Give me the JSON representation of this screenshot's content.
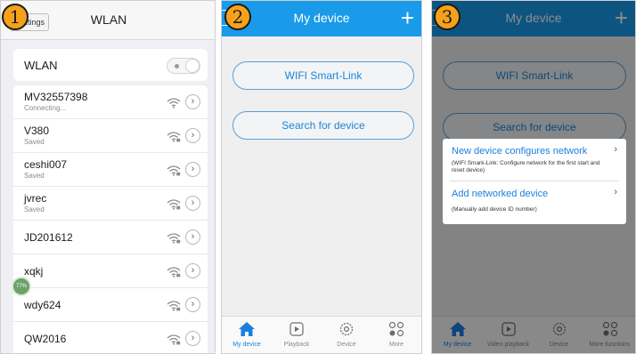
{
  "badges": [
    "1",
    "2",
    "3"
  ],
  "colors": {
    "accent": "#199bea",
    "badge": "#f6a11c",
    "link": "#1a7fe0"
  },
  "screen1": {
    "back_label": "ttings",
    "title": "WLAN",
    "wlan_label": "WLAN",
    "toggle_on": false,
    "networks": [
      {
        "name": "MV32557398",
        "status": "Connecting...",
        "secured": false
      },
      {
        "name": "V380",
        "status": "Saved",
        "secured": true
      },
      {
        "name": "ceshi007",
        "status": "Saved",
        "secured": true
      },
      {
        "name": "jvrec",
        "status": "Saved",
        "secured": true
      },
      {
        "name": "JD201612",
        "status": "",
        "secured": true
      },
      {
        "name": "xqkj",
        "status": "",
        "secured": true
      },
      {
        "name": "wdy624",
        "status": "",
        "secured": true
      },
      {
        "name": "QW2016",
        "status": "",
        "secured": true
      }
    ],
    "floating_ball_text": "77%"
  },
  "screen2": {
    "header_left": "o",
    "title": "My device",
    "plus": "+",
    "wifi_button": "WIFI Smart-Link",
    "search_button": "Search for device",
    "tabs": [
      {
        "label": "My device",
        "icon": "home-icon",
        "active": true
      },
      {
        "label": "Playback",
        "icon": "play-icon",
        "active": false
      },
      {
        "label": "Device",
        "icon": "gear-icon",
        "active": false
      },
      {
        "label": "More",
        "icon": "grid-icon",
        "active": false
      }
    ]
  },
  "screen3": {
    "header_left": "o",
    "title": "My device",
    "plus": "+",
    "wifi_button": "WIFI Smart-Link",
    "search_button": "Search for device",
    "menu": [
      {
        "title": "New device configures network",
        "desc": "(WIFI Smark-Link: Configure network for the first start and reset device)",
        "chevron": "›"
      },
      {
        "title": "Add networked device",
        "desc": "(Manually add device ID number)",
        "chevron": "›"
      }
    ],
    "tabs": [
      {
        "label": "My device",
        "icon": "home-icon",
        "active": true
      },
      {
        "label": "Video playback",
        "icon": "play-icon",
        "active": false
      },
      {
        "label": "Device",
        "icon": "gear-icon",
        "active": false
      },
      {
        "label": "More functions",
        "icon": "grid-icon",
        "active": false
      }
    ]
  }
}
